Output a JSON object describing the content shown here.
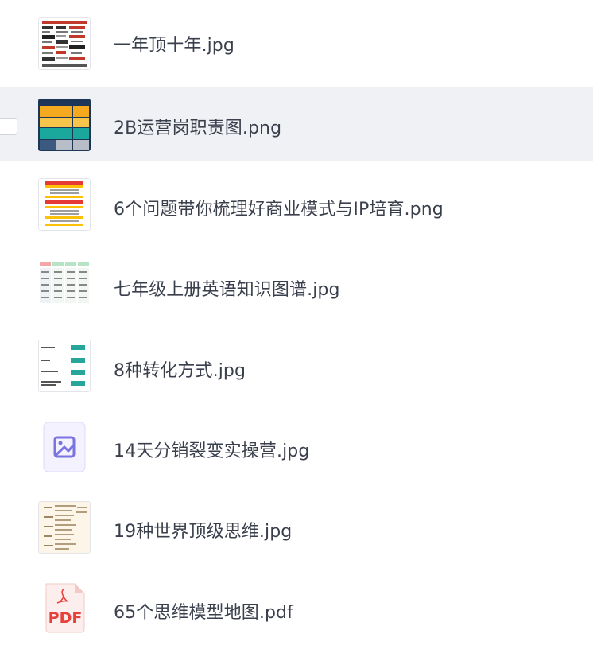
{
  "files": [
    {
      "name": "一年顶十年.jpg",
      "icon": "image-thumbnail-icon"
    },
    {
      "name": "2B运营岗职责图.png",
      "icon": "image-thumbnail-icon",
      "selected": true
    },
    {
      "name": "6个问题带你梳理好商业模式与IP培育.png",
      "icon": "image-thumbnail-icon"
    },
    {
      "name": "七年级上册英语知识图谱.jpg",
      "icon": "image-thumbnail-icon"
    },
    {
      "name": "8种转化方式.jpg",
      "icon": "image-thumbnail-icon"
    },
    {
      "name": "14天分销裂变实操营.jpg",
      "icon": "image-placeholder-icon"
    },
    {
      "name": "19种世界顶级思维.jpg",
      "icon": "image-thumbnail-icon"
    },
    {
      "name": "65个思维模型地图.pdf",
      "icon": "pdf-file-icon",
      "icon_text": "PDF"
    }
  ],
  "colors": {
    "row_selected_bg": "#f0f1f4",
    "text": "#3a3f4c",
    "placeholder_accent": "#7b74e0",
    "pdf_red": "#e8413c"
  }
}
